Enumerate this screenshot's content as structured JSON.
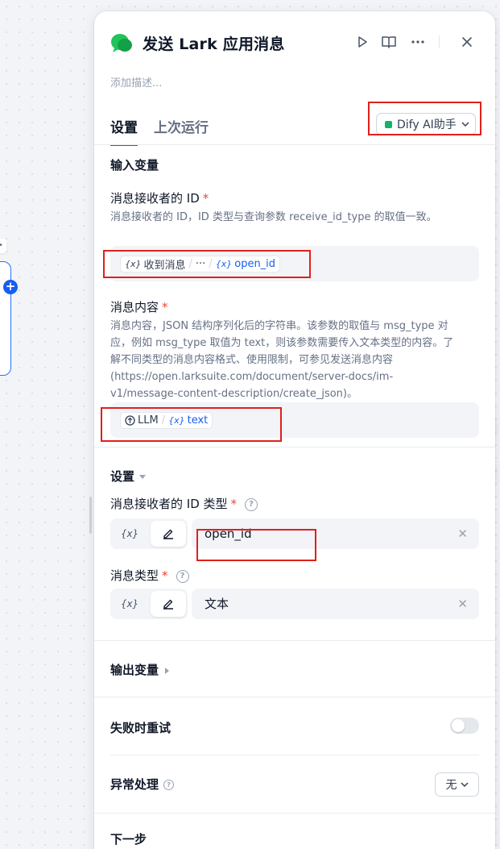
{
  "canvas": {
    "node_tag": "•"
  },
  "panel": {
    "title": "发送 Lark 应用消息",
    "description_placeholder": "添加描述...",
    "tabs": [
      {
        "label": "设置",
        "active": true
      },
      {
        "label": "上次运行",
        "active": false
      }
    ],
    "assistant_label": "Dify AI助手"
  },
  "input_vars": {
    "section_title": "输入变量",
    "receiver_id": {
      "label": "消息接收者的 ID",
      "required_mark": "*",
      "description": "消息接收者的 ID，ID 类型与查询参数 receive_id_type 的取值一致。",
      "var_node": "收到消息",
      "var_ellipsis": "···",
      "var_name": "open_id"
    },
    "content": {
      "label": "消息内容",
      "required_mark": "*",
      "description": "消息内容，JSON 结构序列化后的字符串。该参数的取值与 msg_type 对应，例如 msg_type 取值为 text，则该参数需要传入文本类型的内容。了解不同类型的消息内容格式、使用限制，可参见发送消息内容(https://open.larksuite.com/document/server-docs/im-v1/message-content-description/create_json)。",
      "var_node": "LLM",
      "var_name": "text"
    }
  },
  "settings": {
    "section_title": "设置",
    "id_type": {
      "label": "消息接收者的 ID 类型",
      "required_mark": "*",
      "value": "open_id",
      "var_label": "{x}"
    },
    "msg_type": {
      "label": "消息类型",
      "required_mark": "*",
      "value": "文本",
      "var_label": "{x}"
    }
  },
  "output_vars": {
    "title": "输出变量"
  },
  "retry": {
    "title": "失败时重试",
    "enabled": false
  },
  "error_handling": {
    "title": "异常处理",
    "value": "无"
  },
  "next_step": {
    "title": "下一步"
  },
  "accent_colors": {
    "primary": "#155eef",
    "required": "#f04438",
    "highlight_box": "#e0201b",
    "assistant_dot": "#17b26a"
  }
}
